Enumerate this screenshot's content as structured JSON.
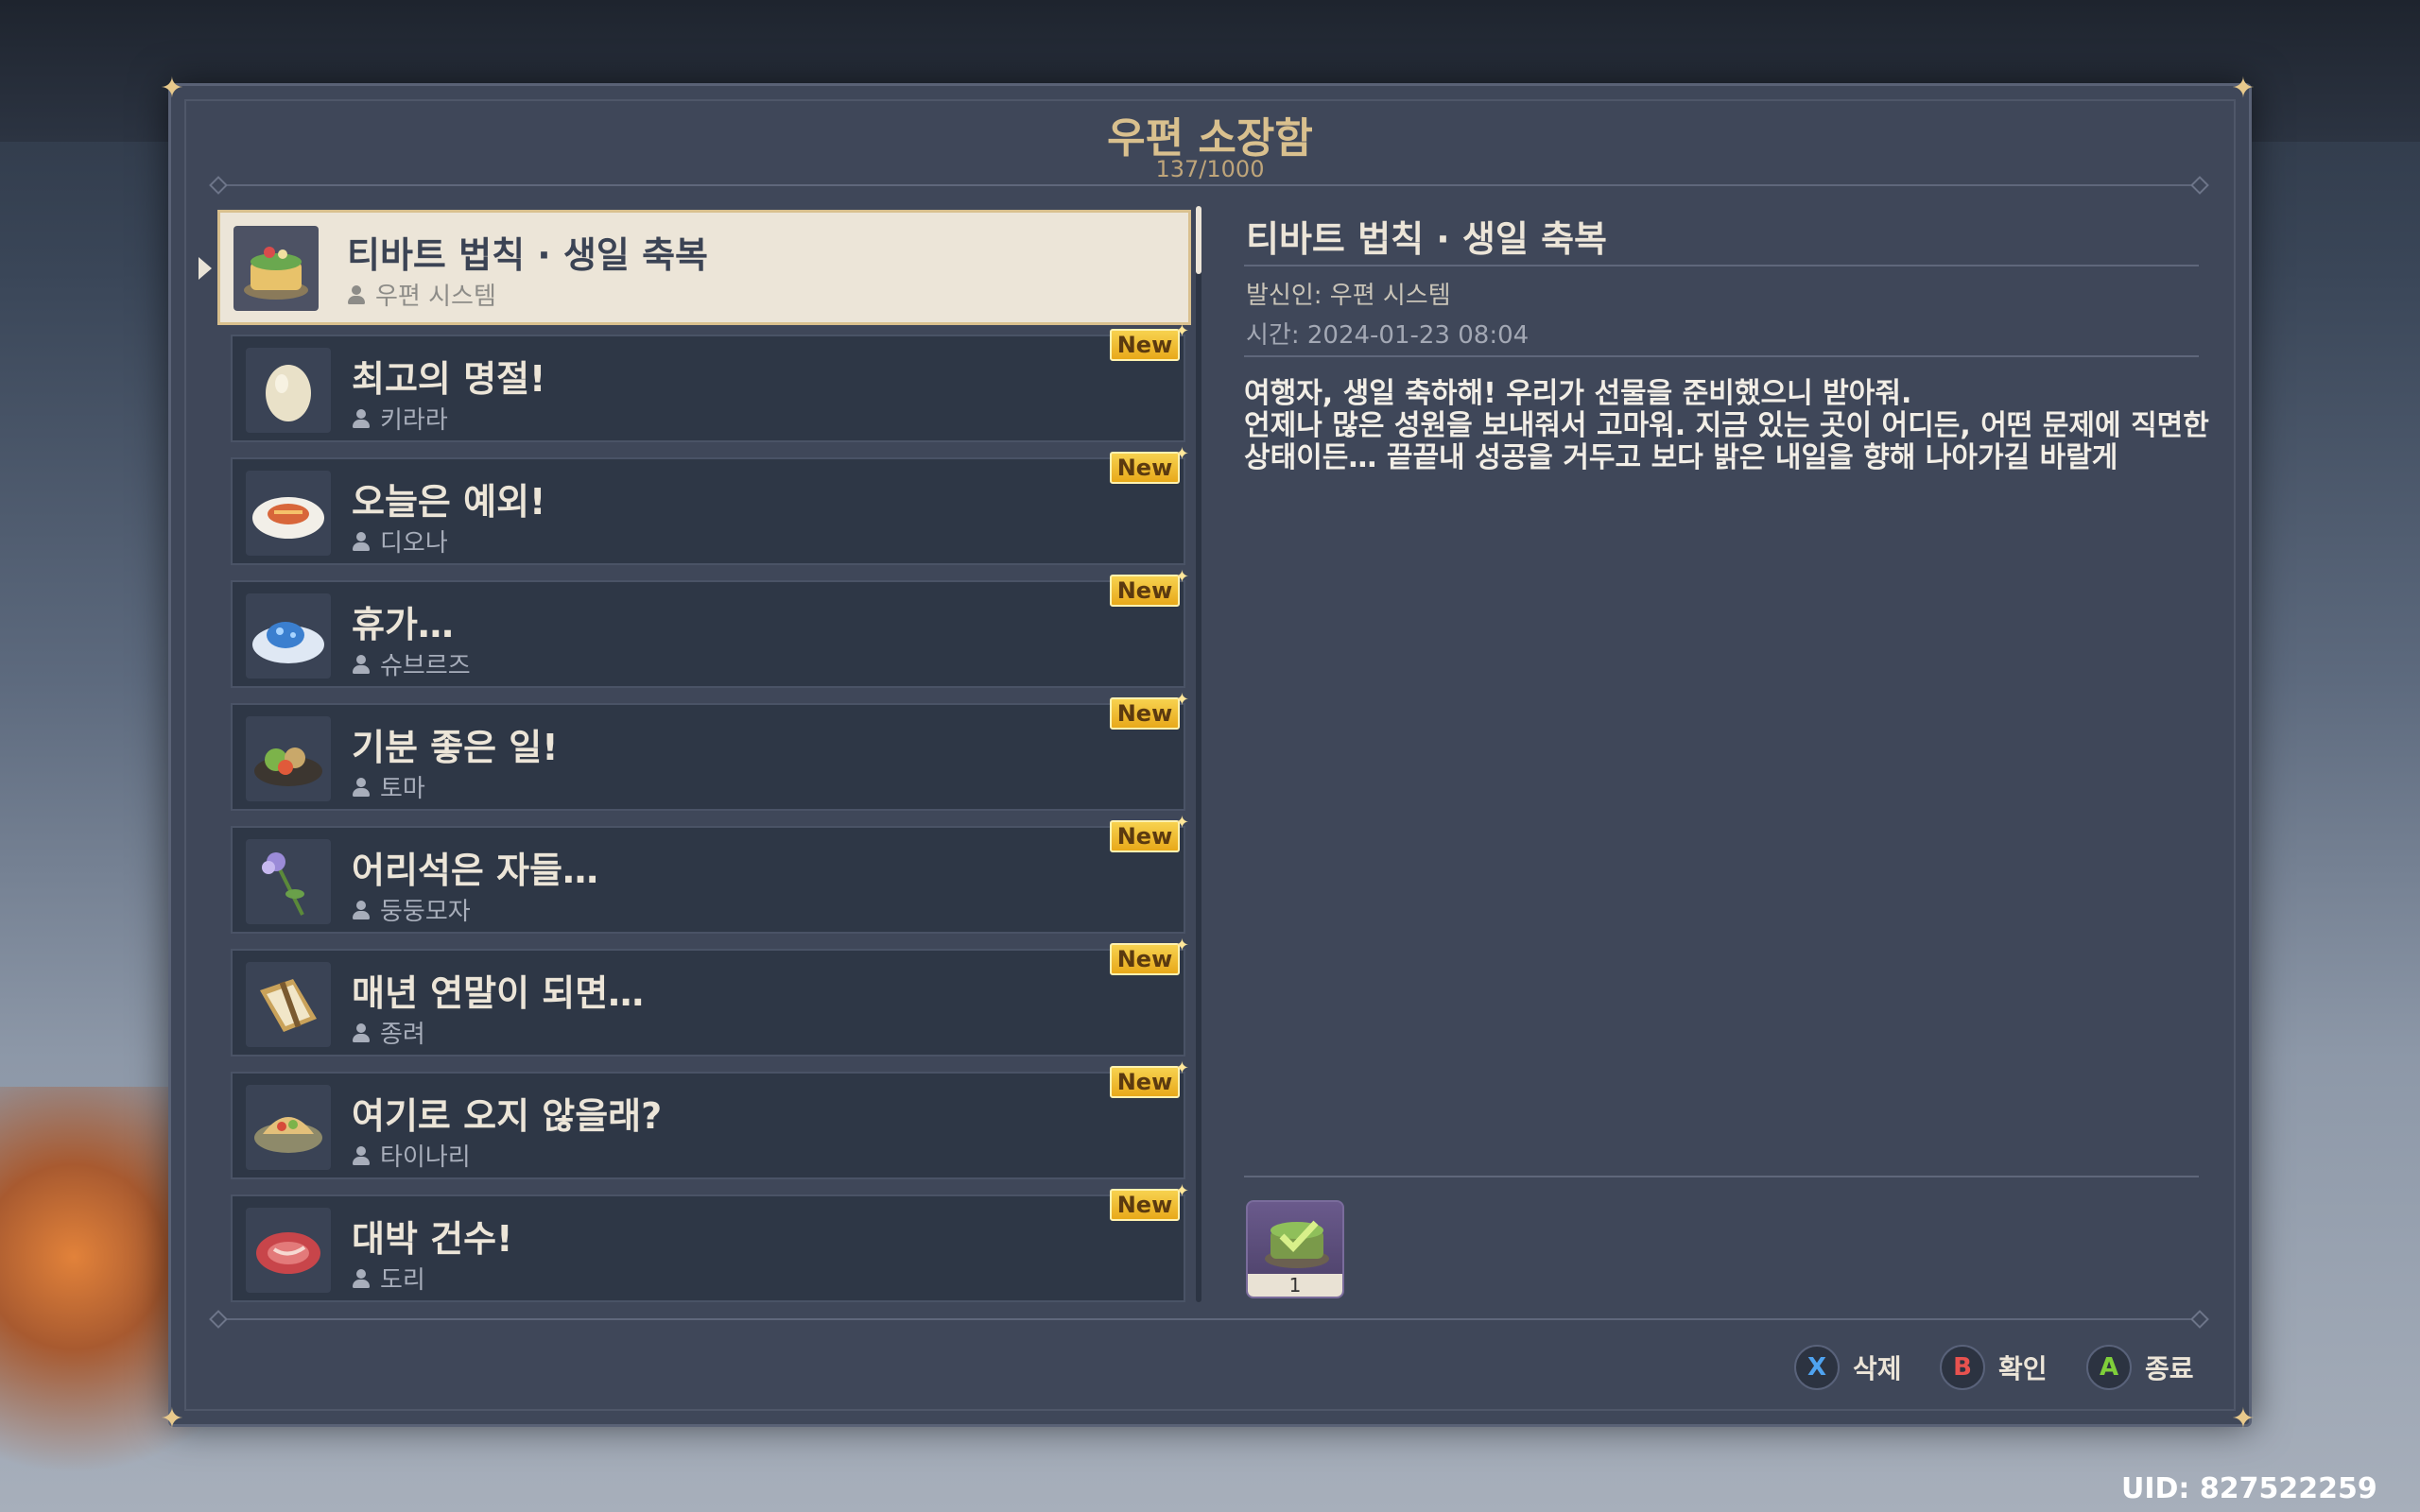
{
  "header": {
    "title": "우편 소장함",
    "count": "137/1000"
  },
  "mail_list": [
    {
      "title": "티바트 법칙 · 생일 축복",
      "sender": "우편 시스템",
      "icon": "cake-icon",
      "is_new": false,
      "selected": true
    },
    {
      "title": "최고의 명절!",
      "sender": "키라라",
      "icon": "egg-icon",
      "is_new": true
    },
    {
      "title": "오늘은 예외!",
      "sender": "디오나",
      "icon": "fish-dish-icon",
      "is_new": true
    },
    {
      "title": "휴가…",
      "sender": "슈브르즈",
      "icon": "blue-dish-icon",
      "is_new": true
    },
    {
      "title": "기분 좋은 일!",
      "sender": "토마",
      "icon": "salad-icon",
      "is_new": true
    },
    {
      "title": "어리석은 자들…",
      "sender": "둥둥모자",
      "icon": "flower-icon",
      "is_new": true
    },
    {
      "title": "매년 연말이 되면…",
      "sender": "종려",
      "icon": "book-icon",
      "is_new": true
    },
    {
      "title": "여기로 오지 않을래?",
      "sender": "타이나리",
      "icon": "taco-icon",
      "is_new": true
    },
    {
      "title": "대박 건수!",
      "sender": "도리",
      "icon": "meat-icon",
      "is_new": true
    }
  ],
  "new_badge": "New",
  "detail": {
    "title": "티바트 법칙 · 생일 축복",
    "sender": "발신인: 우편 시스템",
    "time": "시간: 2024-01-23 08:04",
    "body_lines": [
      "여행자, 생일 축하해! 우리가 선물을 준비했으니 받아줘.",
      "언제나 많은 성원을 보내줘서 고마워. 지금 있는 곳이 어디든, 어떤 문제에 직면한",
      "상태이든… 끝끝내 성공을 거두고 보다 밝은 내일을 향해 나아가길 바랄게"
    ],
    "attachment": {
      "icon": "cake-claimed-icon",
      "count": "1"
    }
  },
  "buttons": {
    "delete": {
      "key": "X",
      "label": "삭제",
      "color": "#4fa3f0"
    },
    "confirm": {
      "key": "B",
      "label": "확인",
      "color": "#e8524f"
    },
    "exit": {
      "key": "A",
      "label": "종료",
      "color": "#7fcf3a"
    }
  },
  "uid": "UID: 827522259",
  "colors": {
    "panel": "#3f4759",
    "gold": "#d9c08e",
    "new_badge": "#f2c23a",
    "selected_bg": "#ece5d8"
  }
}
